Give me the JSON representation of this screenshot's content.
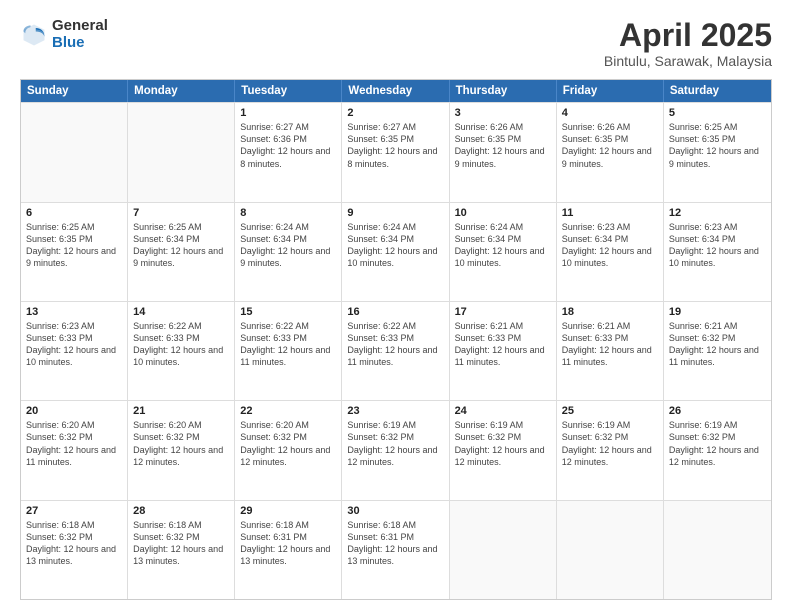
{
  "logo": {
    "general": "General",
    "blue": "Blue"
  },
  "title": "April 2025",
  "subtitle": "Bintulu, Sarawak, Malaysia",
  "header_days": [
    "Sunday",
    "Monday",
    "Tuesday",
    "Wednesday",
    "Thursday",
    "Friday",
    "Saturday"
  ],
  "rows": [
    [
      {
        "day": "",
        "detail": ""
      },
      {
        "day": "",
        "detail": ""
      },
      {
        "day": "1",
        "detail": "Sunrise: 6:27 AM\nSunset: 6:36 PM\nDaylight: 12 hours and 8 minutes."
      },
      {
        "day": "2",
        "detail": "Sunrise: 6:27 AM\nSunset: 6:35 PM\nDaylight: 12 hours and 8 minutes."
      },
      {
        "day": "3",
        "detail": "Sunrise: 6:26 AM\nSunset: 6:35 PM\nDaylight: 12 hours and 9 minutes."
      },
      {
        "day": "4",
        "detail": "Sunrise: 6:26 AM\nSunset: 6:35 PM\nDaylight: 12 hours and 9 minutes."
      },
      {
        "day": "5",
        "detail": "Sunrise: 6:25 AM\nSunset: 6:35 PM\nDaylight: 12 hours and 9 minutes."
      }
    ],
    [
      {
        "day": "6",
        "detail": "Sunrise: 6:25 AM\nSunset: 6:35 PM\nDaylight: 12 hours and 9 minutes."
      },
      {
        "day": "7",
        "detail": "Sunrise: 6:25 AM\nSunset: 6:34 PM\nDaylight: 12 hours and 9 minutes."
      },
      {
        "day": "8",
        "detail": "Sunrise: 6:24 AM\nSunset: 6:34 PM\nDaylight: 12 hours and 9 minutes."
      },
      {
        "day": "9",
        "detail": "Sunrise: 6:24 AM\nSunset: 6:34 PM\nDaylight: 12 hours and 10 minutes."
      },
      {
        "day": "10",
        "detail": "Sunrise: 6:24 AM\nSunset: 6:34 PM\nDaylight: 12 hours and 10 minutes."
      },
      {
        "day": "11",
        "detail": "Sunrise: 6:23 AM\nSunset: 6:34 PM\nDaylight: 12 hours and 10 minutes."
      },
      {
        "day": "12",
        "detail": "Sunrise: 6:23 AM\nSunset: 6:34 PM\nDaylight: 12 hours and 10 minutes."
      }
    ],
    [
      {
        "day": "13",
        "detail": "Sunrise: 6:23 AM\nSunset: 6:33 PM\nDaylight: 12 hours and 10 minutes."
      },
      {
        "day": "14",
        "detail": "Sunrise: 6:22 AM\nSunset: 6:33 PM\nDaylight: 12 hours and 10 minutes."
      },
      {
        "day": "15",
        "detail": "Sunrise: 6:22 AM\nSunset: 6:33 PM\nDaylight: 12 hours and 11 minutes."
      },
      {
        "day": "16",
        "detail": "Sunrise: 6:22 AM\nSunset: 6:33 PM\nDaylight: 12 hours and 11 minutes."
      },
      {
        "day": "17",
        "detail": "Sunrise: 6:21 AM\nSunset: 6:33 PM\nDaylight: 12 hours and 11 minutes."
      },
      {
        "day": "18",
        "detail": "Sunrise: 6:21 AM\nSunset: 6:33 PM\nDaylight: 12 hours and 11 minutes."
      },
      {
        "day": "19",
        "detail": "Sunrise: 6:21 AM\nSunset: 6:32 PM\nDaylight: 12 hours and 11 minutes."
      }
    ],
    [
      {
        "day": "20",
        "detail": "Sunrise: 6:20 AM\nSunset: 6:32 PM\nDaylight: 12 hours and 11 minutes."
      },
      {
        "day": "21",
        "detail": "Sunrise: 6:20 AM\nSunset: 6:32 PM\nDaylight: 12 hours and 12 minutes."
      },
      {
        "day": "22",
        "detail": "Sunrise: 6:20 AM\nSunset: 6:32 PM\nDaylight: 12 hours and 12 minutes."
      },
      {
        "day": "23",
        "detail": "Sunrise: 6:19 AM\nSunset: 6:32 PM\nDaylight: 12 hours and 12 minutes."
      },
      {
        "day": "24",
        "detail": "Sunrise: 6:19 AM\nSunset: 6:32 PM\nDaylight: 12 hours and 12 minutes."
      },
      {
        "day": "25",
        "detail": "Sunrise: 6:19 AM\nSunset: 6:32 PM\nDaylight: 12 hours and 12 minutes."
      },
      {
        "day": "26",
        "detail": "Sunrise: 6:19 AM\nSunset: 6:32 PM\nDaylight: 12 hours and 12 minutes."
      }
    ],
    [
      {
        "day": "27",
        "detail": "Sunrise: 6:18 AM\nSunset: 6:32 PM\nDaylight: 12 hours and 13 minutes."
      },
      {
        "day": "28",
        "detail": "Sunrise: 6:18 AM\nSunset: 6:32 PM\nDaylight: 12 hours and 13 minutes."
      },
      {
        "day": "29",
        "detail": "Sunrise: 6:18 AM\nSunset: 6:31 PM\nDaylight: 12 hours and 13 minutes."
      },
      {
        "day": "30",
        "detail": "Sunrise: 6:18 AM\nSunset: 6:31 PM\nDaylight: 12 hours and 13 minutes."
      },
      {
        "day": "",
        "detail": ""
      },
      {
        "day": "",
        "detail": ""
      },
      {
        "day": "",
        "detail": ""
      }
    ]
  ]
}
